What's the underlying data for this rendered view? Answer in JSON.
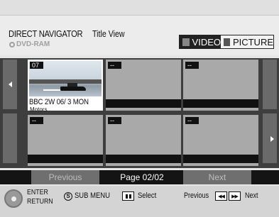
{
  "header": {
    "app_title": "DIRECT NAVIGATOR",
    "view_title": "Title View",
    "disc": "DVD-RAM",
    "toggle": {
      "video_label": "VIDEO",
      "picture_label": "PICTURE",
      "active": "VIDEO"
    }
  },
  "thumbnails": [
    {
      "number": "07",
      "caption": "BBC 2W  06/ 3  MON",
      "name": "Motors",
      "selected": true
    },
    {
      "number": "--",
      "caption": "",
      "name": "",
      "selected": false
    },
    {
      "number": "--",
      "caption": "",
      "name": "",
      "selected": false
    },
    {
      "number": "--",
      "caption": "",
      "name": "",
      "selected": false
    },
    {
      "number": "--",
      "caption": "",
      "name": "",
      "selected": false
    },
    {
      "number": "--",
      "caption": "",
      "name": "",
      "selected": false
    }
  ],
  "pager": {
    "previous": "Previous",
    "page": "Page 02/02",
    "next": "Next"
  },
  "footer": {
    "enter": "ENTER",
    "return": "RETURN",
    "s_key": "S",
    "sub_menu": "SUB MENU",
    "select": "Select",
    "previous": "Previous",
    "skip_back_glyph": "◀◀",
    "skip_fwd_glyph": "▶▶",
    "next": "Next"
  },
  "icons": {
    "disc": "disc-icon",
    "left_arrow": "arrow-left-icon",
    "right_arrow": "arrow-right-icon",
    "dial": "dial-icon",
    "pause": "pause-icon",
    "skip_back": "skip-back-icon",
    "skip_forward": "skip-forward-icon"
  },
  "colors": {
    "grid_bg": "#3e3e3e",
    "thumb_bg": "#a9a9a9",
    "selected_bg": "#ffffff",
    "pager_bg": "#141414",
    "pager_btn": "#6f6f6f"
  }
}
